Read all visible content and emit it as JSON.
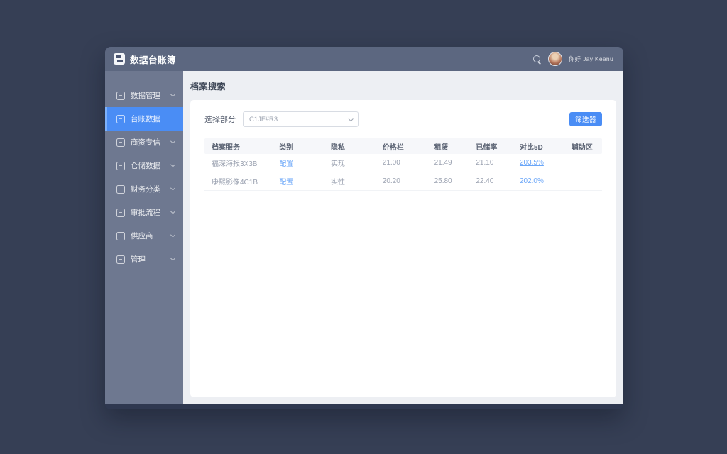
{
  "window": {
    "logo_title": "数据台账簿",
    "user_greeting": "你好 Jay Keanu"
  },
  "sidebar": {
    "items": [
      {
        "label": "数据管理",
        "icon": "dashboard-icon",
        "active": false,
        "has_chevron": true
      },
      {
        "label": "台账数据",
        "icon": "ledger-icon",
        "active": true,
        "has_chevron": false
      },
      {
        "label": "商资专信",
        "icon": "chat-icon",
        "active": false,
        "has_chevron": true
      },
      {
        "label": "仓储数据",
        "icon": "archive-icon",
        "active": false,
        "has_chevron": true
      },
      {
        "label": "财务分类",
        "icon": "finance-icon",
        "active": false,
        "has_chevron": true
      },
      {
        "label": "审批流程",
        "icon": "mail-icon",
        "active": false,
        "has_chevron": true
      },
      {
        "label": "供应商",
        "icon": "approval-icon",
        "active": false,
        "has_chevron": true
      },
      {
        "label": "管理",
        "icon": "settings-icon",
        "active": false,
        "has_chevron": true
      }
    ]
  },
  "page": {
    "title": "档案搜索"
  },
  "filter": {
    "label": "选择部分",
    "select_value": "C1JF#R3",
    "button_label": "筛选器"
  },
  "table": {
    "headers": [
      "档案服务",
      "类别",
      "隐私",
      "价格栏",
      "租赁",
      "已储率",
      "对比5D",
      "辅助区"
    ],
    "rows": [
      {
        "cells": [
          "福深海报3X3B",
          "配置",
          "实现",
          "21.00",
          "21.49",
          "21.10",
          "203.5%",
          ""
        ]
      },
      {
        "cells": [
          "康熙影像4C1B",
          "配置",
          "实性",
          "20.20",
          "25.80",
          "22.40",
          "202.0%",
          ""
        ]
      }
    ]
  },
  "colors": {
    "accent_blue": "#4a8df5",
    "header_bar": "#5c6780",
    "sidebar": "#6e7890",
    "desktop_background": "#363f55"
  }
}
